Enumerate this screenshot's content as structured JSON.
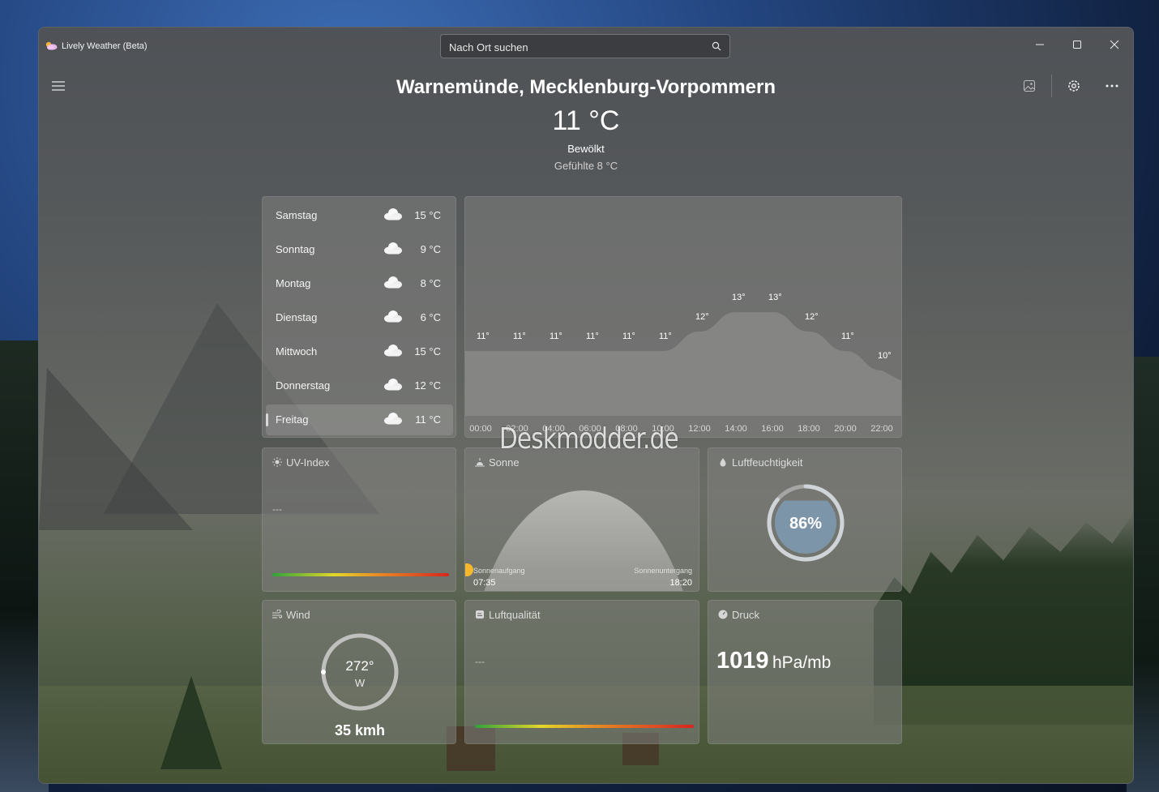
{
  "app": {
    "title": "Lively Weather (Beta)"
  },
  "search": {
    "placeholder": "Nach Ort suchen"
  },
  "location": {
    "name": "Warnemünde, Mecklenburg-Vorpommern",
    "temperature": "11 °C",
    "condition": "Bewölkt",
    "feels_like": "Gefühlte 8 °C"
  },
  "forecast": [
    {
      "day": "Samstag",
      "temp": "15 °C",
      "icon": "cloud-icon",
      "selected": false
    },
    {
      "day": "Sonntag",
      "temp": "9 °C",
      "icon": "cloud-icon",
      "selected": false
    },
    {
      "day": "Montag",
      "temp": "8 °C",
      "icon": "cloud-icon",
      "selected": false
    },
    {
      "day": "Dienstag",
      "temp": "6 °C",
      "icon": "cloud-icon",
      "selected": false
    },
    {
      "day": "Mittwoch",
      "temp": "15 °C",
      "icon": "cloud-icon",
      "selected": false
    },
    {
      "day": "Donnerstag",
      "temp": "12 °C",
      "icon": "cloud-icon",
      "selected": false
    },
    {
      "day": "Freitag",
      "temp": "11 °C",
      "icon": "partly-cloudy-icon",
      "selected": true
    }
  ],
  "hourly": {
    "times": [
      "00:00",
      "02:00",
      "04:00",
      "06:00",
      "08:00",
      "10:00",
      "12:00",
      "14:00",
      "16:00",
      "18:00",
      "20:00",
      "22:00"
    ],
    "temps": [
      "11°",
      "11°",
      "11°",
      "11°",
      "11°",
      "11°",
      "12°",
      "13°",
      "13°",
      "12°",
      "11°",
      "10°"
    ],
    "values": [
      11,
      11,
      11,
      11,
      11,
      11,
      12,
      13,
      13,
      12,
      11,
      10
    ]
  },
  "uv": {
    "title": "UV-Index",
    "value": "---"
  },
  "sun": {
    "title": "Sonne",
    "sunrise_label": "Sonnenaufgang",
    "sunrise": "07:35",
    "sunset_label": "Sonnenuntergang",
    "sunset": "18:20"
  },
  "humidity": {
    "title": "Luftfeuchtigkeit",
    "value": "86%",
    "level": 0.86
  },
  "wind": {
    "title": "Wind",
    "degrees": "272°",
    "direction": "W",
    "speed": "35 kmh"
  },
  "air": {
    "title": "Luftqualität",
    "value": "---"
  },
  "pressure": {
    "title": "Druck",
    "value": "1019",
    "unit": "hPa/mb"
  },
  "watermark": "Deskmodder.de",
  "colors": {
    "sun": "#f5b72e",
    "humidity_fill": "#7f9bb3"
  }
}
